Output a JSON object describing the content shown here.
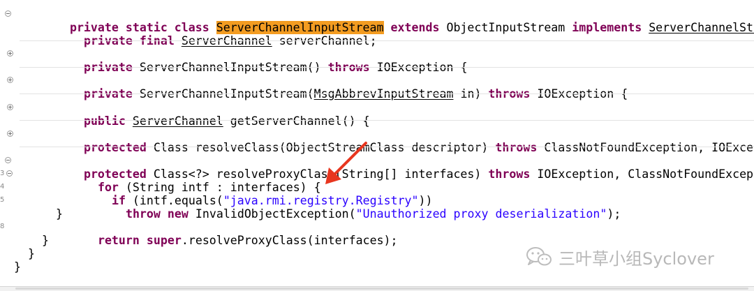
{
  "code": {
    "header": {
      "kw1": "private static class ",
      "class_name": "ServerChannelInputStream",
      "kw_extends": " extends ",
      "super_class": "ObjectInputStream ",
      "kw_implements": "implements ",
      "interface_name": "ServerChannelStream"
    },
    "field": {
      "kw": "private final ",
      "type": "ServerChannel",
      "rest": " serverChannel;"
    },
    "ctor1": {
      "kw": "private ",
      "sig": "ServerChannelInputStream() ",
      "throws": "throws",
      "rest": " IOException {"
    },
    "ctor2": {
      "kw": "private ",
      "sig": "ServerChannelInputStream(",
      "param_type": "MsgAbbrevInputStream",
      "param_rest": " in) ",
      "throws": "throws",
      "rest": " IOException {"
    },
    "getter": {
      "kw": "public ",
      "type": "ServerChannel",
      "rest": " getServerChannel() {"
    },
    "resolve_class": {
      "kw": "protected ",
      "sig": "Class resolveClass(ObjectStreamClass descriptor) ",
      "throws": "throws",
      "rest": " ClassNotFoundException, IOExceptio"
    },
    "resolve_proxy": {
      "kw": "protected ",
      "sig": "Class<?> resolveProxyClass(String[] interfaces) ",
      "throws": "throws",
      "rest": " IOException, ClassNotFoundException"
    },
    "for_line": {
      "kw": "for",
      "rest": " (String intf : interfaces) {"
    },
    "if_line": {
      "kw": "if",
      "pre": " (intf.equals(",
      "str": "\"java.rmi.registry.Registry\"",
      "post": "))"
    },
    "throw_line": {
      "kw1": "throw ",
      "kw2": "new",
      "pre": " InvalidObjectException(",
      "str": "\"Unauthorized proxy deserialization\"",
      "post": ");"
    },
    "close_brace": "}",
    "return_line": {
      "kw1": "return ",
      "kw2": "super",
      "rest": ".resolveProxyClass(interfaces);"
    }
  },
  "line_numbers": {
    "l3": "3",
    "l4": "4",
    "l5": "5",
    "l8": "8"
  },
  "watermark": {
    "text": "三叶草小组Syclover"
  },
  "colors": {
    "keyword": "#7f0055",
    "string": "#2a00ff",
    "highlight": "#f39c21",
    "arrow": "#e8361f"
  },
  "icons": {
    "fold_collapsed": "fold-collapsed-icon",
    "fold_expanded": "fold-expanded-icon",
    "watermark_logo": "wechat-icon",
    "annotation": "red-arrow-icon"
  }
}
